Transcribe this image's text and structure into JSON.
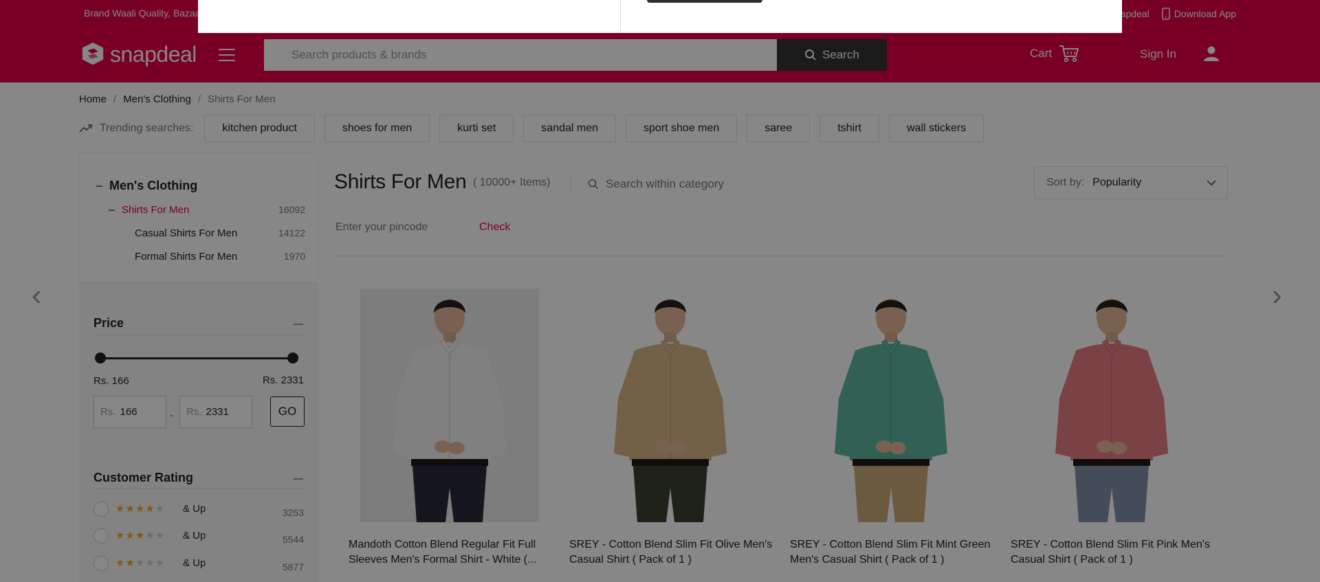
{
  "top_strip": {
    "tagline": "Brand Waali Quality, Bazaar Waali Deal",
    "link_sell": "Sell On Snapdeal",
    "link_download": "Download App"
  },
  "header": {
    "logo_text": "snapdeal",
    "search_placeholder": "Search products & brands",
    "search_button": "Search",
    "cart_label": "Cart",
    "signin_label": "Sign In"
  },
  "breadcrumb": [
    "Home",
    "Men's Clothing",
    "Shirts For Men"
  ],
  "trending": {
    "label": "Trending searches:",
    "chips": [
      "kitchen product",
      "shoes for men",
      "kurti set",
      "sandal men",
      "sport shoe men",
      "saree",
      "tshirt",
      "wall stickers"
    ]
  },
  "sidebar": {
    "category_root": "Men's Clothing",
    "categories": [
      {
        "name": "Shirts For Men",
        "count": "16092"
      },
      {
        "name": "Casual Shirts For Men",
        "count": "14122"
      },
      {
        "name": "Formal Shirts For Men",
        "count": "1970"
      }
    ],
    "price": {
      "title": "Price",
      "min_label": "Rs. 166",
      "max_label": "Rs. 2331",
      "currency": "Rs.",
      "min_value": "166",
      "max_value": "2331",
      "separator": "-",
      "go": "GO"
    },
    "rating": {
      "title": "Customer Rating",
      "up_label": "& Up",
      "rows": [
        {
          "stars": 4,
          "count": "3253"
        },
        {
          "stars": 3,
          "count": "5544"
        },
        {
          "stars": 2,
          "count": "5877"
        }
      ]
    }
  },
  "main": {
    "title": "Shirts For Men",
    "item_count": "( 10000+ Items)",
    "category_search_placeholder": "Search within category",
    "sort_label": "Sort by:",
    "sort_value": "Popularity",
    "pincode_placeholder": "Enter your pincode",
    "check_label": "Check"
  },
  "products": [
    {
      "title": "Mandoth Cotton Blend Regular Fit Full Sleeves Men's Formal Shirt - White (...",
      "shirt_color": "#f2f2f4",
      "pant_color": "#2b2d3a",
      "bg": "#ececee"
    },
    {
      "title": "SREY - Cotton Blend Slim Fit Olive Men's Casual Shirt ( Pack of 1 )",
      "shirt_color": "#d9b887",
      "pant_color": "#3b4030",
      "bg": "#ffffff"
    },
    {
      "title": "SREY - Cotton Blend Slim Fit Mint Green Men's Casual Shirt ( Pack of 1 )",
      "shirt_color": "#5fb5a0",
      "pant_color": "#cba97a",
      "bg": "#ffffff"
    },
    {
      "title": "SREY - Cotton Blend Slim Fit Pink Men's Casual Shirt ( Pack of 1 )",
      "shirt_color": "#e87d85",
      "pant_color": "#8390a8",
      "bg": "#ffffff"
    }
  ],
  "colors": {
    "brand": "#e40046",
    "overlay": "rgba(0,0,0,0.47)"
  }
}
